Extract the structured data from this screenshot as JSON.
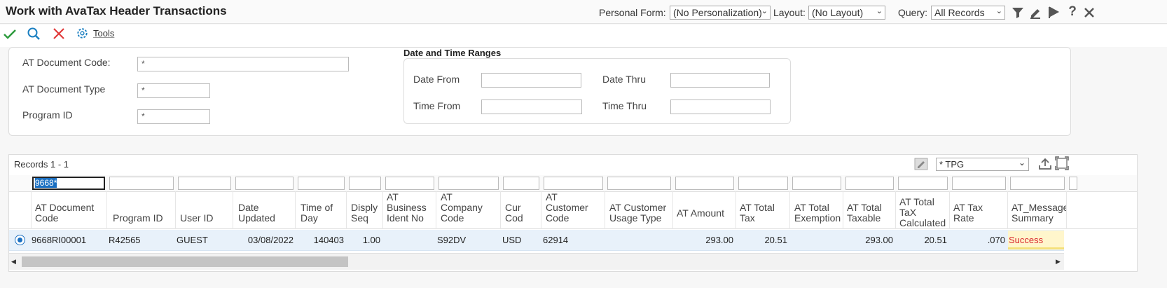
{
  "header": {
    "title": "Work with AvaTax Header Transactions",
    "personal_form_label": "Personal Form:",
    "personal_form_value": "(No Personalization)",
    "layout_label": "Layout:",
    "layout_value": "(No Layout)",
    "query_label": "Query:",
    "query_value": "All Records"
  },
  "toolbar": {
    "tools_label": "Tools"
  },
  "filters": {
    "doc_code_label": "AT Document Code:",
    "doc_code_value": "*",
    "doc_type_label": "AT Document Type",
    "doc_type_value": "*",
    "program_id_label": "Program ID",
    "program_id_value": "*"
  },
  "date_ranges": {
    "heading": "Date and Time Ranges",
    "date_from_label": "Date From",
    "date_thru_label": "Date Thru",
    "time_from_label": "Time From",
    "time_thru_label": "Time Thru"
  },
  "grid": {
    "records": "Records 1 - 1",
    "format_value": "* TPG",
    "filter_first": "9668*",
    "columns": [
      "AT Document Code",
      "Program ID",
      "User ID",
      "Date Updated",
      "Time of Day",
      "Disply Seq",
      "AT Business Ident No",
      "AT Company Code",
      "Cur Cod",
      "AT Customer Code",
      "AT Customer Usage Type",
      "AT Amount",
      "AT Total Tax",
      "AT Total Exemption",
      "AT Total Taxable",
      "AT Total TaX Calculated",
      "AT Tax Rate",
      "AT_Message Summary"
    ],
    "row": [
      "9668RI00001",
      "R42565",
      "GUEST",
      "03/08/2022",
      "140403",
      "1.00",
      "",
      "S92DV",
      "USD",
      "62914",
      "",
      "293.00",
      "20.51",
      "",
      "293.00",
      "20.51",
      ".070",
      "Success"
    ]
  },
  "colors": {
    "accent": "#1a7fc1",
    "success_text": "#d9252b",
    "row_bg": "#e8f1fa",
    "highlight": "#fff3b0"
  }
}
